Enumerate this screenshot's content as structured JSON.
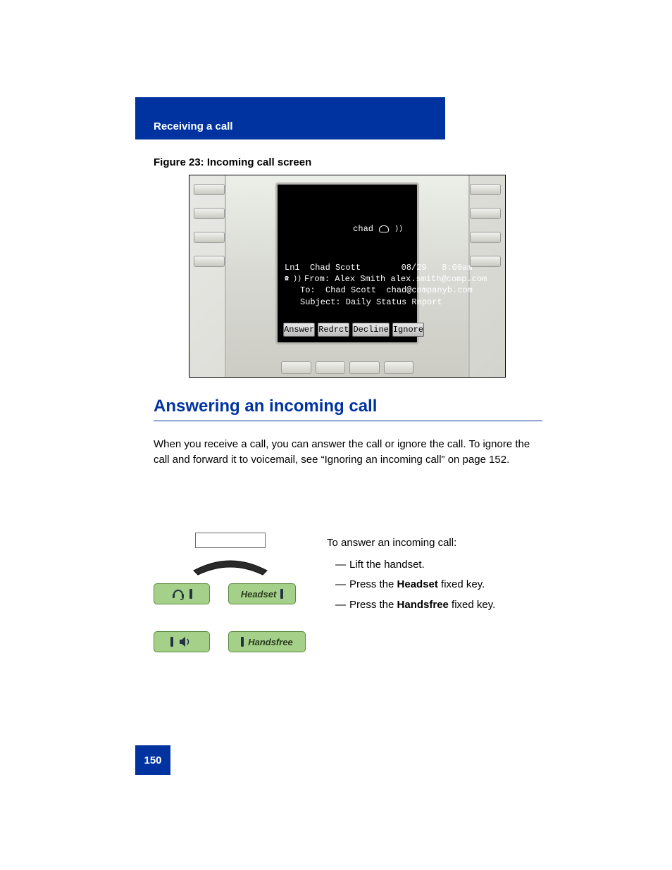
{
  "header": {
    "running_head": "Receiving a call"
  },
  "figure": {
    "caption": "Figure 23: Incoming call screen",
    "lcd": {
      "user": "chad",
      "line1": "Ln1  Chad Scott        08/29   8:00am",
      "from": "From: Alex Smith alex.smith@comp.com",
      "to": "To:  Chad Scott  chad@companyb.com",
      "subject": "Subject: Daily Status Report",
      "softkeys": [
        "Answer",
        "Redrct",
        "Decline",
        "Ignore"
      ]
    }
  },
  "section": {
    "title": "Answering an incoming call"
  },
  "paragraph1": {
    "prefix": "When you receive a call, you can answer the call or ignore the call. To ignore the call and forward it to voicemail, see ",
    "link": "“Ignoring an incoming call” on page 152",
    "suffix": "."
  },
  "instruction": {
    "lead": "To answer an incoming call:",
    "items": [
      "Lift the handset.",
      "Press the Headset fixed key.",
      "Press the Handsfree fixed key."
    ],
    "key_labels": {
      "headset": "Headset",
      "handsfree": "Handsfree"
    }
  },
  "page_number": "150"
}
